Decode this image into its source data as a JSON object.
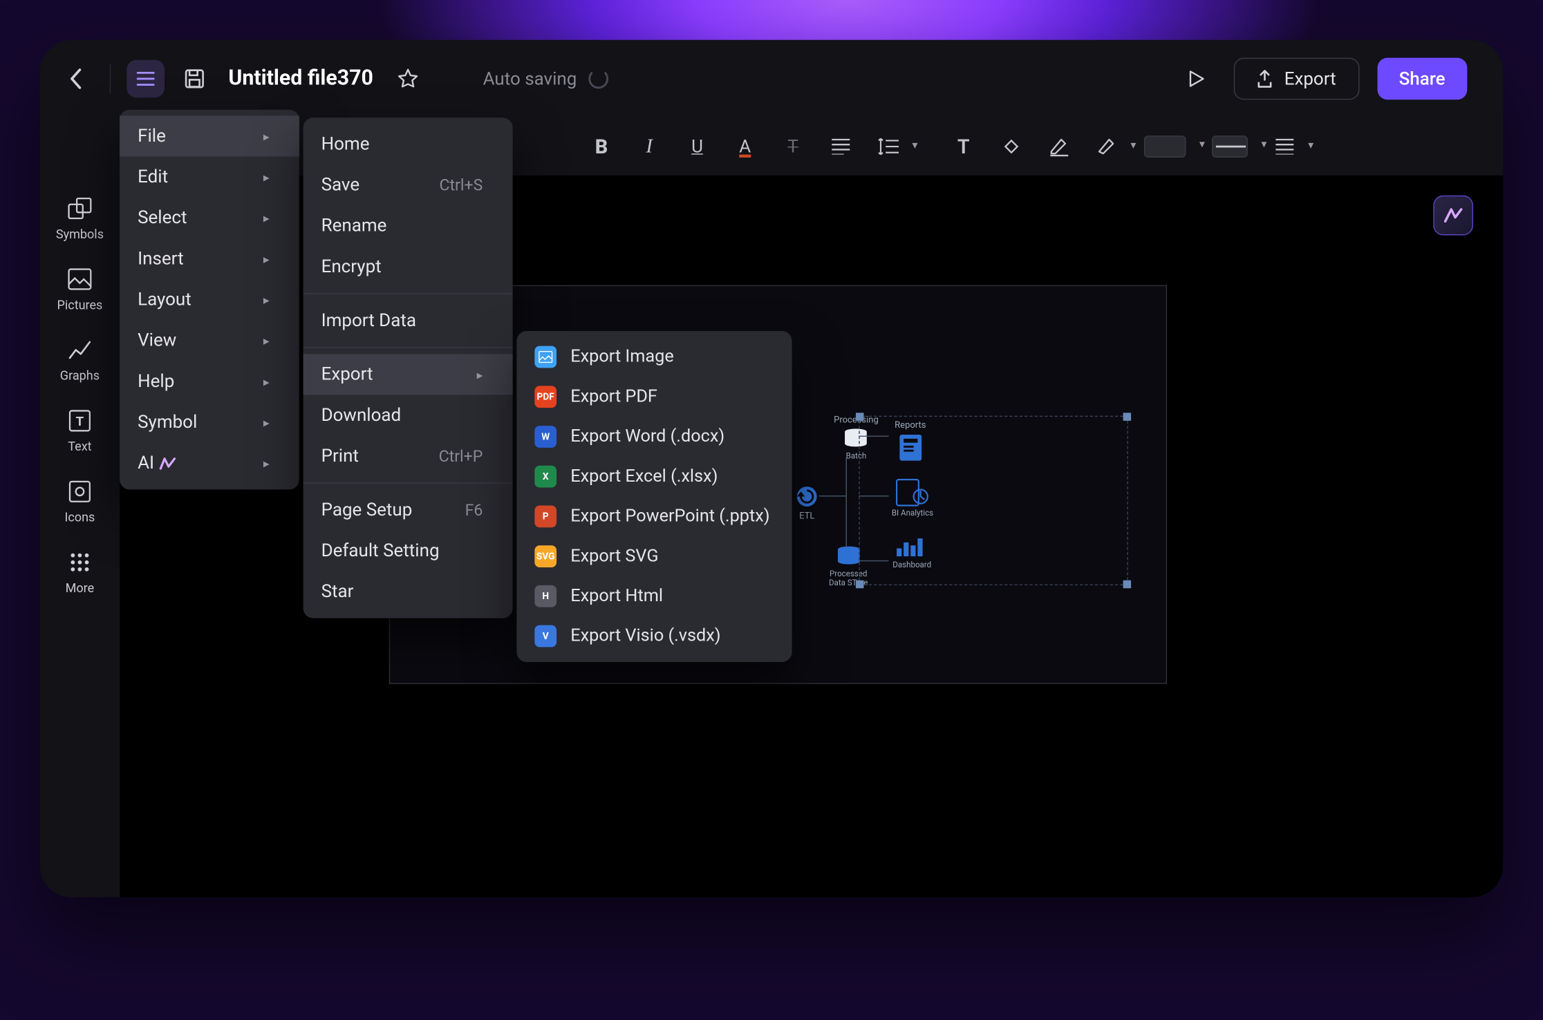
{
  "header": {
    "filename": "Untitled file370",
    "status": "Auto saving",
    "export_label": "Export",
    "share_label": "Share"
  },
  "sidebar": {
    "items": [
      {
        "label": "Symbols"
      },
      {
        "label": "Pictures"
      },
      {
        "label": "Graphs"
      },
      {
        "label": "Text"
      },
      {
        "label": "Icons"
      },
      {
        "label": "More"
      }
    ]
  },
  "menu": {
    "l1": [
      {
        "label": "File",
        "submenu": true
      },
      {
        "label": "Edit",
        "submenu": true
      },
      {
        "label": "Select",
        "submenu": true
      },
      {
        "label": "Insert",
        "submenu": true
      },
      {
        "label": "Layout",
        "submenu": true
      },
      {
        "label": "View",
        "submenu": true
      },
      {
        "label": "Help",
        "submenu": true
      },
      {
        "label": "Symbol",
        "submenu": true
      },
      {
        "label": "AI",
        "submenu": true,
        "ai": true
      }
    ],
    "l2": [
      {
        "label": "Home"
      },
      {
        "label": "Save",
        "shortcut": "Ctrl+S"
      },
      {
        "label": "Rename"
      },
      {
        "label": "Encrypt"
      },
      {
        "type": "div"
      },
      {
        "label": "Import Data"
      },
      {
        "type": "div"
      },
      {
        "label": "Export",
        "submenu": true
      },
      {
        "label": "Download"
      },
      {
        "label": "Print",
        "shortcut": "Ctrl+P"
      },
      {
        "type": "div"
      },
      {
        "label": "Page Setup",
        "shortcut": "F6"
      },
      {
        "label": "Default Setting"
      },
      {
        "label": "Star"
      }
    ],
    "l3": [
      {
        "badge": "IMG",
        "badge_color": "#3ea2f4",
        "label": "Export Image"
      },
      {
        "badge": "PDF",
        "badge_color": "#e5421f",
        "label": "Export PDF"
      },
      {
        "badge": "W",
        "badge_color": "#2a5fd1",
        "label": "Export Word (.docx)"
      },
      {
        "badge": "X",
        "badge_color": "#1f8a4c",
        "label": "Export Excel (.xlsx)"
      },
      {
        "badge": "P",
        "badge_color": "#d24726",
        "label": "Export PowerPoint (.pptx)"
      },
      {
        "badge": "SVG",
        "badge_color": "#f7a728",
        "label": "Export SVG"
      },
      {
        "badge": "H",
        "badge_color": "#5a5a64",
        "label": "Export Html"
      },
      {
        "badge": "V",
        "badge_color": "#3a78e0",
        "label": "Export Visio (.vsdx)"
      }
    ]
  },
  "canvas": {
    "nodes": {
      "processing": "Processing",
      "batch": "Batch",
      "etl": "ETL",
      "pds": "Processed\nData STore",
      "reports": "Reports",
      "bi": "BI Analytics",
      "dash": "Dashboard"
    }
  }
}
